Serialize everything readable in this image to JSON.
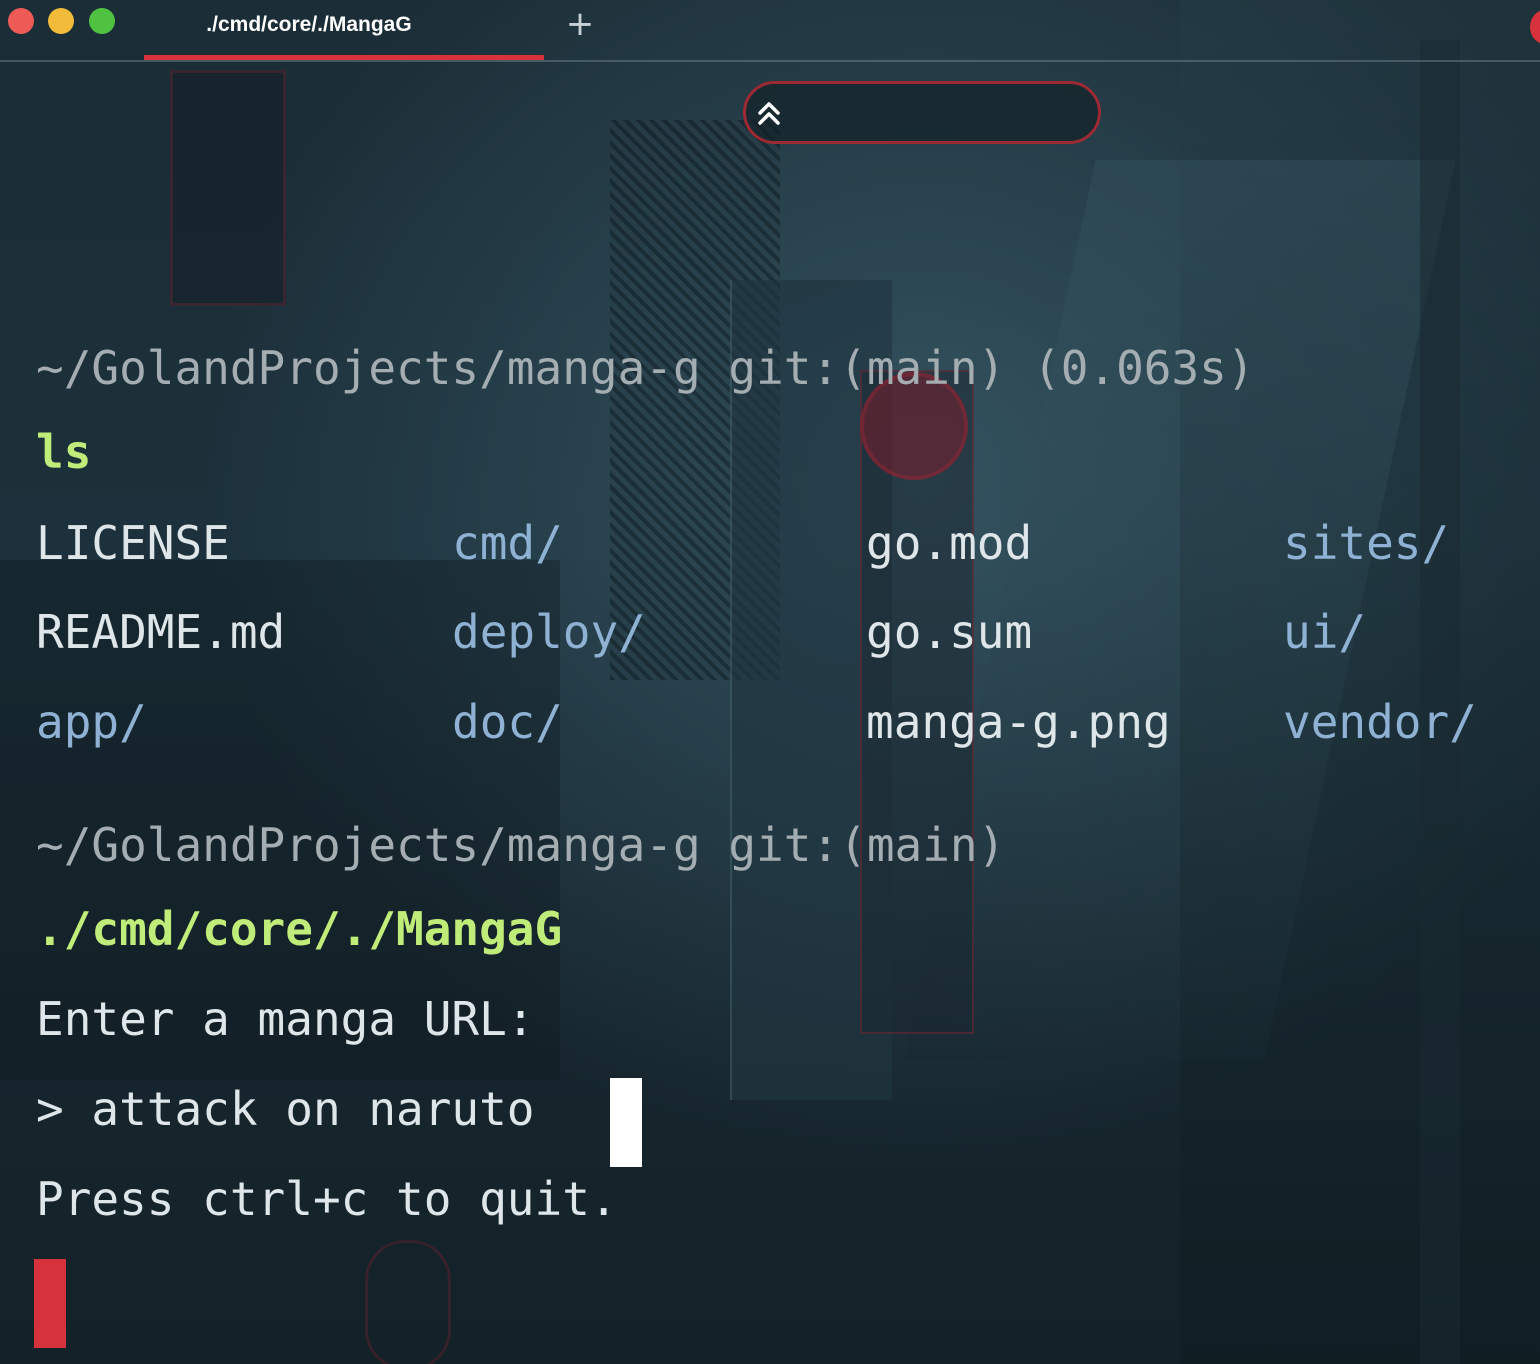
{
  "window": {
    "tab_title": "./cmd/core/./MangaG",
    "new_tab_label": "+"
  },
  "scroll_control": {
    "icon": "double-chevron-up-icon"
  },
  "blocks": [
    {
      "prompt": "~/GolandProjects/manga-g git:(main) (0.063s)",
      "command": "ls",
      "output_grid": [
        [
          {
            "text": "LICENSE",
            "kind": "file"
          },
          {
            "text": "cmd/",
            "kind": "dir"
          },
          {
            "text": "go.mod",
            "kind": "file"
          },
          {
            "text": "sites/",
            "kind": "dir"
          }
        ],
        [
          {
            "text": "README.md",
            "kind": "file"
          },
          {
            "text": "deploy/",
            "kind": "dir"
          },
          {
            "text": "go.sum",
            "kind": "file"
          },
          {
            "text": "ui/",
            "kind": "dir"
          }
        ],
        [
          {
            "text": "app/",
            "kind": "dir"
          },
          {
            "text": "doc/",
            "kind": "dir"
          },
          {
            "text": "manga-g.png",
            "kind": "file"
          },
          {
            "text": "vendor/",
            "kind": "dir"
          }
        ]
      ]
    },
    {
      "prompt": "~/GolandProjects/manga-g git:(main)",
      "command": "./cmd/core/./MangaG",
      "output_lines": [
        "Enter a manga URL:",
        "> attack on naruto",
        "Press ctrl+c to quit."
      ]
    }
  ],
  "colors": {
    "accent": "#d8323c",
    "command": "#c0ec7a",
    "directory": "#8fb2d4",
    "prompt": "#a4adb1"
  }
}
